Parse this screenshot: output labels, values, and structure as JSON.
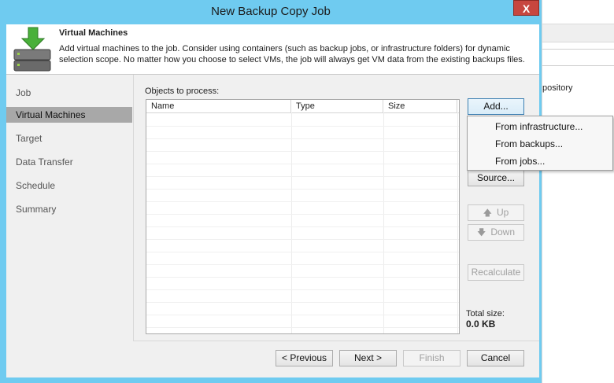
{
  "window": {
    "title": "New Backup Copy Job",
    "close_glyph": "X"
  },
  "header": {
    "title": "Virtual Machines",
    "description": "Add virtual machines to the job. Consider using containers (such as backup jobs, or infrastructure folders) for dynamic selection scope. No matter how you choose to select VMs, the job will always get VM data from the existing backups files.",
    "icon": "server-stack-with-down-arrow-icon"
  },
  "nav": {
    "items": [
      {
        "label": "Job"
      },
      {
        "label": "Virtual Machines",
        "active": true
      },
      {
        "label": "Target"
      },
      {
        "label": "Data Transfer"
      },
      {
        "label": "Schedule"
      },
      {
        "label": "Summary"
      }
    ]
  },
  "objects": {
    "label": "Objects to process:",
    "columns": [
      "Name",
      "Type",
      "Size"
    ],
    "rows": []
  },
  "side_buttons": {
    "add": "Add...",
    "source": "Source...",
    "up": "Up",
    "down": "Down",
    "recalculate": "Recalculate"
  },
  "add_menu": {
    "items": [
      "From infrastructure...",
      "From backups...",
      "From jobs..."
    ]
  },
  "total": {
    "label": "Total size:",
    "value": "0.0 KB"
  },
  "footer": {
    "previous": "< Previous",
    "next": "Next >",
    "finish": "Finish",
    "cancel": "Cancel"
  },
  "background_app": {
    "text": "pository"
  },
  "colors": {
    "window_frame": "#6fcbf0",
    "close_button": "#c7463f",
    "selected_nav": "#a8a8a8"
  }
}
